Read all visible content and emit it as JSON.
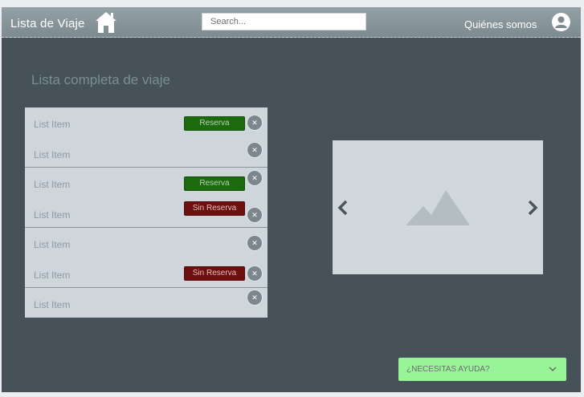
{
  "header": {
    "title": "Lista de Viaje",
    "home_icon": "home-icon",
    "search_placeholder": "Search...",
    "about_link": "Quiénes somos",
    "avatar_icon": "user-avatar-icon"
  },
  "main": {
    "title": "Lista completa de viaje",
    "list": [
      {
        "items": [
          {
            "label": "List Item",
            "badge": "Reserva",
            "badge_color": "#1b6a0d"
          },
          {
            "label": "List Item",
            "badge": null
          }
        ]
      },
      {
        "items": [
          {
            "label": "List Item",
            "badge": "Reserva",
            "badge_color": "#1b6a0d"
          },
          {
            "label": "List Item",
            "badge": "Sin Reserva",
            "badge_color": "#6e0f0f"
          }
        ]
      },
      {
        "items": [
          {
            "label": "List Item",
            "badge": null
          },
          {
            "label": "List Item",
            "badge": "Sin Reserva",
            "badge_color": "#6e0f0f"
          }
        ]
      },
      {
        "items": [
          {
            "label": "List Item",
            "badge": null
          }
        ]
      }
    ],
    "carousel": {
      "image_icon": "image-placeholder-icon",
      "prev_icon": "chevron-left-icon",
      "next_icon": "chevron-right-icon"
    }
  },
  "help": {
    "label": "¿NECESITAS AYUDA?",
    "icon": "chevron-down-icon",
    "bg": "#97f497"
  },
  "colors": {
    "background": "#465257",
    "header": "#8a989d",
    "list_bg": "#ced6dc",
    "reserve": "#1b6a0d",
    "no_reserve": "#6e0f0f"
  }
}
